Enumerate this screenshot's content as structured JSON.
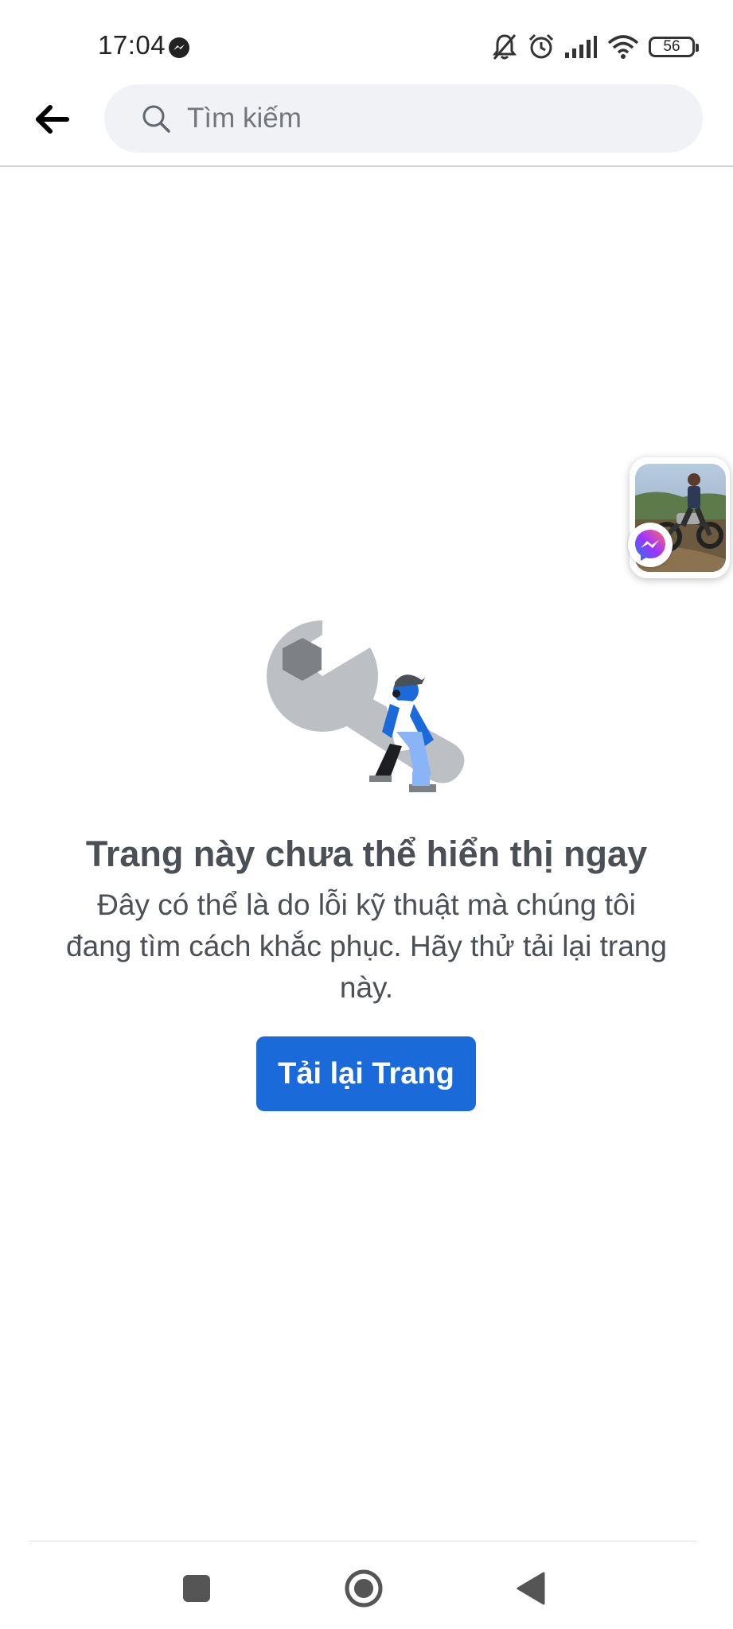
{
  "status_bar": {
    "time": "17:04",
    "battery": "56",
    "icons": [
      "messenger-icon",
      "mute-bell-icon",
      "alarm-icon",
      "signal-icon",
      "wifi-icon",
      "battery-icon"
    ]
  },
  "header": {
    "back_icon": "arrow-left-icon",
    "search_placeholder": "Tìm kiếm",
    "search_value": ""
  },
  "error": {
    "title": "Trang này chưa thể hiển thị ngay",
    "description": "Đây có thể là do lỗi kỹ thuật mà chúng tôi đang tìm cách khắc phục. Hãy thử tải lại trang này.",
    "reload_label": "Tải lại Trang"
  },
  "nav_bar": {
    "icons": [
      "recents-square-icon",
      "home-circle-icon",
      "back-triangle-icon"
    ]
  },
  "colors": {
    "accent": "#1b6ad9",
    "search_bg": "#f0f2f5",
    "text": "#4b4f56"
  }
}
